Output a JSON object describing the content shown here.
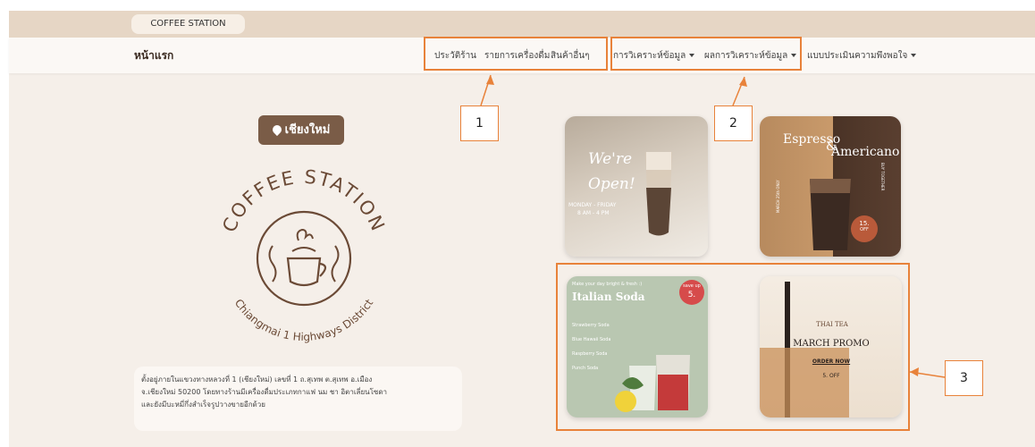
{
  "browser_tab": {
    "title": "COFFEE STATION"
  },
  "navbar": {
    "brand": "หน้าแรก",
    "group1": [
      "ประวัติร้าน",
      "รายการเครื่องดื่ม",
      "สินค้าอื่นๆ"
    ],
    "group2": [
      "การวิเคราะห์ข้อมูล",
      "ผลการวิเคราะห์ข้อมูล"
    ],
    "survey": "แบบประเมินความพึงพอใจ"
  },
  "annotations": {
    "callout1": "1",
    "callout2": "2",
    "callout3": "3"
  },
  "location_badge": {
    "label": "เชียงใหม่"
  },
  "logo": {
    "arc_top": "COFFEE STATION",
    "arc_bottom": "Chiangmai 1 Highways District"
  },
  "description": {
    "line1": "ตั้งอยู่ภายในแขวงทางหลวงที่ 1 (เชียงใหม่) เลขที่ 1 ถ.สุเทพ ต.สุเทพ อ.เมือง",
    "line2": "จ.เชียงใหม่ 50200 โดยทางร้านมีเครื่องดื่มประเภทกาแฟ นม ชา อิตาเลี่ยนโซดา",
    "line3": "และยังมีบะหมี่กึ่งสำเร็จรูปวางขายอีกด้วย"
  },
  "promo_cards": {
    "card1": {
      "line1": "We're",
      "line2": "Open!",
      "line3": "MONDAY - FRIDAY",
      "line4": "8 AM - 4 PM"
    },
    "card2": {
      "title1": "Espresso",
      "title2": "&",
      "title3": "Americano",
      "side_left": "MARCH 25th ONLY",
      "side_right": "BUY TOGETHER",
      "badge1": "15.",
      "badge2": "OFF"
    },
    "card3": {
      "tagline": "Make your day bright & fresh :)",
      "title": "Italian Soda",
      "badge1": "save up",
      "badge2": "5.",
      "items": [
        "Strawberry Soda",
        "Blue Hawaii Soda",
        "Raspberry Soda",
        "Punch Soda"
      ]
    },
    "card4": {
      "arc": "THAI TEA",
      "title": "MARCH PROMO",
      "cta": "ORDER NOW",
      "discount": "5. OFF"
    }
  }
}
